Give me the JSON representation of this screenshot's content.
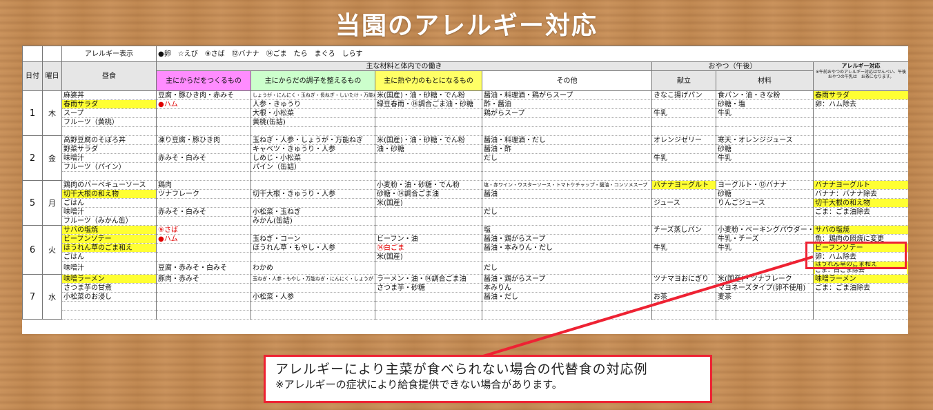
{
  "title": "当園のアレルギー対応",
  "legend": {
    "label": "アレルギー表示",
    "items": "●卵　☆えび　⑨さば　⑫バナナ　⑭ごま　たら　まぐろ　しらす"
  },
  "headers": {
    "date": "日付",
    "weekday": "曜日",
    "lunch": "昼食",
    "group": "主な材料と体内での働き",
    "body": "主にからだをつくるもの",
    "condition": "主にからだの調子を整えるもの",
    "energy": "主に熱や力のもとになるもの",
    "other": "その他",
    "snack_group": "おやつ（午後）",
    "snack_menu": "献立",
    "snack_material": "材料",
    "allergy": "アレルギー対応",
    "allergy_note": "※午前おやつのアレルギー対応はせんべい、午後おやつの牛乳は　お茶になります。"
  },
  "days": [
    {
      "date": "1",
      "weekday": "木",
      "lunch": [
        "麻婆丼",
        "春雨サラダ",
        "スープ",
        "フルーツ（黄桃）",
        ""
      ],
      "body": [
        "豆腐・豚ひき肉・赤みそ",
        "●ハム",
        "",
        "",
        ""
      ],
      "condition": [
        "しょうが・にんにく・玉ねぎ・長ねぎ・しいたけ・万能ねぎ",
        "人参・きゅうり",
        "大根・小松菜",
        "黄桃(缶詰)",
        ""
      ],
      "energy": [
        "米(国産)・油・砂糖・でん粉",
        "緑豆春雨・⑭調合ごま油・砂糖",
        "",
        "",
        ""
      ],
      "other": [
        "醤油・料理酒・鶏がらスープ",
        "酢・醤油",
        "鶏がらスープ",
        "",
        ""
      ],
      "snack": [
        "きなこ揚げパン",
        "",
        "牛乳",
        "",
        ""
      ],
      "material": [
        "食パン・油・きな粉",
        "砂糖・塩",
        "牛乳",
        "",
        ""
      ],
      "allergy": [
        "春雨サラダ",
        "卵：ハム除去",
        "",
        "",
        ""
      ]
    },
    {
      "date": "2",
      "weekday": "金",
      "lunch": [
        "高野豆腐のそぼろ丼",
        "野菜サラダ",
        "味噌汁",
        "フルーツ（パイン）",
        ""
      ],
      "body": [
        "凍り豆腐・豚ひき肉",
        "",
        "赤みそ・白みそ",
        "",
        ""
      ],
      "condition": [
        "玉ねぎ・人参・しょうが・万能ねぎ",
        "キャベツ・きゅうり・人参",
        "しめじ・小松菜",
        "パイン（缶詰）",
        ""
      ],
      "energy": [
        "米(国産)・油・砂糖・でん粉",
        "油・砂糖",
        "",
        "",
        ""
      ],
      "other": [
        "醤油・料理酒・だし",
        "醤油・酢",
        "だし",
        "",
        ""
      ],
      "snack": [
        "オレンジゼリー",
        "",
        "牛乳",
        "",
        ""
      ],
      "material": [
        "寒天・オレンジジュース",
        "砂糖",
        "牛乳",
        "",
        ""
      ],
      "allergy": [
        "",
        "",
        "",
        "",
        ""
      ]
    },
    {
      "date": "5",
      "weekday": "月",
      "lunch": [
        "鶏肉のバーベキューソース",
        "切干大根の和え物",
        "ごはん",
        "味噌汁",
        "フルーツ（みかん缶）"
      ],
      "body": [
        "鶏肉",
        "ツナフレーク",
        "",
        "赤みそ・白みそ",
        ""
      ],
      "condition": [
        "",
        "切干大根・きゅうり・人参",
        "",
        "小松菜・玉ねぎ",
        "みかん(缶詰)"
      ],
      "energy": [
        "小麦粉・油・砂糖・でん粉",
        "砂糖・⑭調合ごま油",
        "米(国産)",
        "",
        ""
      ],
      "other": [
        "塩・赤ワイン・ウスターソース・トマトケチャップ・醤油・コンソメスープ",
        "醤油",
        "",
        "だし",
        ""
      ],
      "snack": [
        "バナナヨーグルト",
        "",
        "ジュース",
        "",
        ""
      ],
      "material": [
        "ヨーグルト・⑫バナナ",
        "砂糖",
        "りんごジュース",
        "",
        ""
      ],
      "allergy": [
        "バナナヨーグルト",
        "バナナ：バナナ除去",
        "切干大根の和え物",
        "ごま：ごま油除去",
        ""
      ]
    },
    {
      "date": "6",
      "weekday": "火",
      "lunch": [
        "サバの塩焼",
        "ビーフンソテー",
        "ほうれん草のごま和え",
        "ごはん",
        "味噌汁"
      ],
      "body": [
        "⑨さば",
        "●ハム",
        "",
        "",
        "豆腐・赤みそ・白みそ"
      ],
      "condition": [
        "",
        "玉ねぎ・コーン",
        "ほうれん草・もやし・人参",
        "",
        "わかめ"
      ],
      "energy": [
        "",
        "ビーフン・油",
        "⑭白ごま",
        "米(国産)",
        ""
      ],
      "other": [
        "塩",
        "醤油・鶏がらスープ",
        "醤油・本みりん・だし",
        "",
        "だし"
      ],
      "snack": [
        "チーズ蒸しパン",
        "",
        "牛乳",
        "",
        ""
      ],
      "material": [
        "小麦粉・ベーキングパウダー・砂糖",
        "牛乳・チーズ",
        "牛乳",
        "",
        ""
      ],
      "allergy": [
        "サバの塩焼",
        "魚：鶏肉の照焼に変更",
        "ビーフンソテー",
        "卵：ハム除去",
        "ほうれん草のごま和え",
        "ごま：白ごま除去"
      ]
    },
    {
      "date": "7",
      "weekday": "水",
      "lunch": [
        "味噌ラーメン",
        "さつま芋の甘煮",
        "小松菜のお浸し",
        "",
        ""
      ],
      "body": [
        "豚肉・赤みそ",
        "",
        "",
        "",
        ""
      ],
      "condition": [
        "玉ねぎ・人参・もやし・万能ねぎ・にんにく・しょうが",
        "",
        "小松菜・人参",
        "",
        ""
      ],
      "energy": [
        "ラーメン・油・⑭調合ごま油",
        "さつま芋・砂糖",
        "",
        "",
        ""
      ],
      "other": [
        "醤油・鶏がらスープ",
        "本みりん",
        "醤油・だし",
        "",
        ""
      ],
      "snack": [
        "ツナマヨおにぎり",
        "",
        "お茶",
        "",
        ""
      ],
      "material": [
        "米(国産)・ツナフレーク",
        "マヨネーズタイプ(卵不使用)",
        "麦茶",
        "",
        ""
      ],
      "allergy": [
        "味噌ラーメン",
        "ごま：ごま油除去",
        "",
        "",
        ""
      ]
    }
  ],
  "note": {
    "line1": "アレルギーにより主菜が食べられない場合の代替食の対応例",
    "line2": "※アレルギーの症状により給食提供できない場合があります。"
  },
  "colors": {
    "highlight": "#ffff33",
    "callout": "#ee2233",
    "header_pink": "#ff8cff",
    "header_green": "#ccffcc",
    "header_yellow": "#ffff66"
  }
}
